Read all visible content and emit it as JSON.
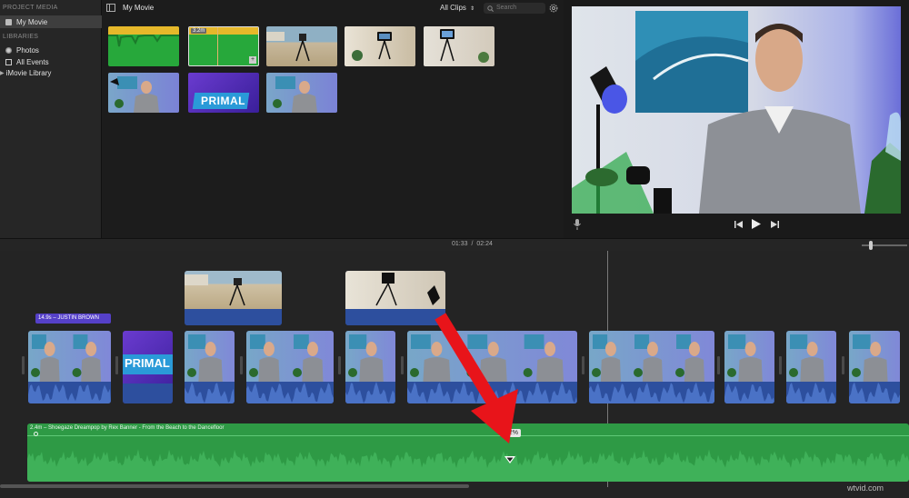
{
  "sidebar": {
    "project_media_heading": "PROJECT MEDIA",
    "project_item": "My Movie",
    "libraries_heading": "LIBRARIES",
    "items": [
      {
        "label": "Photos",
        "icon": "photos-icon"
      },
      {
        "label": "All Events",
        "icon": "events-icon"
      },
      {
        "label": "iMovie Library",
        "icon": "chevron-right-icon"
      }
    ]
  },
  "browser": {
    "title": "My Movie",
    "filter": "All Clips",
    "search_placeholder": "Search",
    "thumb_duration": "3.2m",
    "primal_text": "PRIMAL"
  },
  "viewer": {
    "mic_icon": "mic-icon",
    "prev_icon": "skip-back-icon",
    "play_icon": "play-icon",
    "next_icon": "skip-forward-icon"
  },
  "timeline": {
    "current_time": "01:33",
    "separator": "/",
    "total_time": "02:24",
    "title_clip": "14.9s – JUSTIN BROWN",
    "music_clip": "2.4m – Shoegaze Dreampop by Rex Banner - From the Beach to the Dancefloor",
    "volume_badge": "62%",
    "primal_text": "PRIMAL"
  },
  "watermark": "wtvid.com",
  "colors": {
    "accent": "#2e9a45",
    "video_clip_audio": "#2d4f9e",
    "title_clip": "#5540c8",
    "arrow": "#e8141a"
  }
}
